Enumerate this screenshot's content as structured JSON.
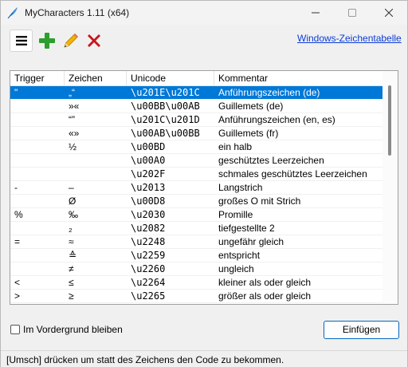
{
  "window": {
    "title": "MyCharacters 1.11 (x64)",
    "icons": {
      "app": "feather-icon",
      "minimize": "minimize-icon",
      "maximize": "maximize-icon",
      "close": "close-icon"
    }
  },
  "toolbar": {
    "icons": [
      "menu-icon",
      "plus-icon",
      "pencil-icon",
      "delete-x-icon"
    ],
    "colors": {
      "plus": "#2e9e2e",
      "delete": "#c8151b",
      "pencil": "#f4b400"
    },
    "charmap_link": "Windows-Zeichentabelle"
  },
  "table": {
    "columns": [
      "Trigger",
      "Zeichen",
      "Unicode",
      "Kommentar"
    ],
    "selected_row": 0,
    "selection_color": "#0078d7",
    "rows": [
      {
        "trigger": "\"",
        "char": "„“",
        "unicode": "\\u201E\\u201C",
        "comment": "Anführungszeichen (de)"
      },
      {
        "trigger": "",
        "char": "»«",
        "unicode": "\\u00BB\\u00AB",
        "comment": "Guillemets (de)"
      },
      {
        "trigger": "",
        "char": "“”",
        "unicode": "\\u201C\\u201D",
        "comment": "Anführungszeichen (en, es)"
      },
      {
        "trigger": "",
        "char": "«»",
        "unicode": "\\u00AB\\u00BB",
        "comment": "Guillemets (fr)"
      },
      {
        "trigger": "",
        "char": "½",
        "unicode": "\\u00BD",
        "comment": "ein halb"
      },
      {
        "trigger": "",
        "char": "",
        "unicode": "\\u00A0",
        "comment": "geschütztes Leerzeichen"
      },
      {
        "trigger": "",
        "char": "",
        "unicode": "\\u202F",
        "comment": "schmales geschütztes Leerzeichen"
      },
      {
        "trigger": "-",
        "char": "–",
        "unicode": "\\u2013",
        "comment": "Langstrich"
      },
      {
        "trigger": "",
        "char": "Ø",
        "unicode": "\\u00D8",
        "comment": "großes O mit Strich"
      },
      {
        "trigger": "%",
        "char": "‰",
        "unicode": "\\u2030",
        "comment": "Promille"
      },
      {
        "trigger": "",
        "char": "₂",
        "unicode": "\\u2082",
        "comment": "tiefgestellte 2"
      },
      {
        "trigger": "=",
        "char": "≈",
        "unicode": "\\u2248",
        "comment": "ungefähr gleich"
      },
      {
        "trigger": "",
        "char": "≙",
        "unicode": "\\u2259",
        "comment": "entspricht"
      },
      {
        "trigger": "",
        "char": "≠",
        "unicode": "\\u2260",
        "comment": "ungleich"
      },
      {
        "trigger": "<",
        "char": "≤",
        "unicode": "\\u2264",
        "comment": "kleiner als oder gleich"
      },
      {
        "trigger": ">",
        "char": "≥",
        "unicode": "\\u2265",
        "comment": "größer als oder gleich"
      }
    ]
  },
  "footer": {
    "checkbox_label": "Im Vordergrund bleiben",
    "checkbox_checked": false,
    "insert_button": "Einfügen"
  },
  "status": {
    "text": "[Umsch] drücken um statt des Zeichens den Code zu bekommen."
  }
}
